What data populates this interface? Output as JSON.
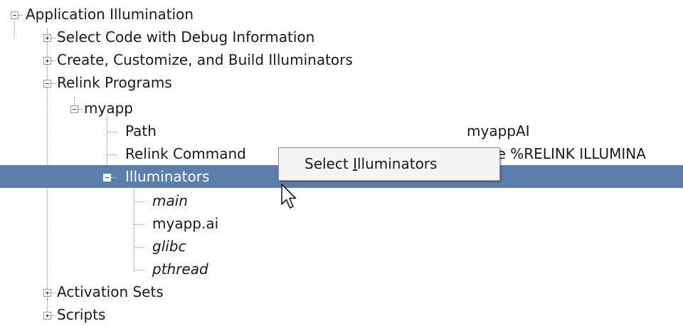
{
  "tree": {
    "root": {
      "label": "Application Illumination",
      "expanded": true
    },
    "select_code": {
      "label": "Select Code with Debug Information",
      "expanded": false
    },
    "build": {
      "label": "Create, Customize, and Build Illuminators",
      "expanded": false
    },
    "relink": {
      "label": "Relink Programs",
      "expanded": true
    },
    "myapp": {
      "label": "myapp",
      "expanded": true
    },
    "path": {
      "label": "Path",
      "value": "myappAI"
    },
    "relink_command": {
      "label": "Relink Command",
      "value": "make %RELINK ILLUMINA"
    },
    "illuminators": {
      "label": "Illuminators",
      "expanded": true,
      "selected": true
    },
    "ill_main": {
      "label": "main"
    },
    "ill_myapp_ai": {
      "label": "myapp.ai"
    },
    "ill_glibc": {
      "label": "glibc"
    },
    "ill_pthread": {
      "label": "pthread"
    },
    "activation_sets": {
      "label": "Activation Sets",
      "expanded": false
    },
    "scripts": {
      "label": "Scripts",
      "expanded": false
    }
  },
  "context_menu": {
    "item_prefix": "Select ",
    "item_mnemonic": "I",
    "item_suffix": "lluminators"
  },
  "colors": {
    "selection": "#5b7fac",
    "tree_lines": "#8a8a8a",
    "menu_bg": "#f4f4f4"
  },
  "icons": [
    "expander-minus-icon",
    "expander-plus-icon",
    "mouse-cursor-icon"
  ]
}
